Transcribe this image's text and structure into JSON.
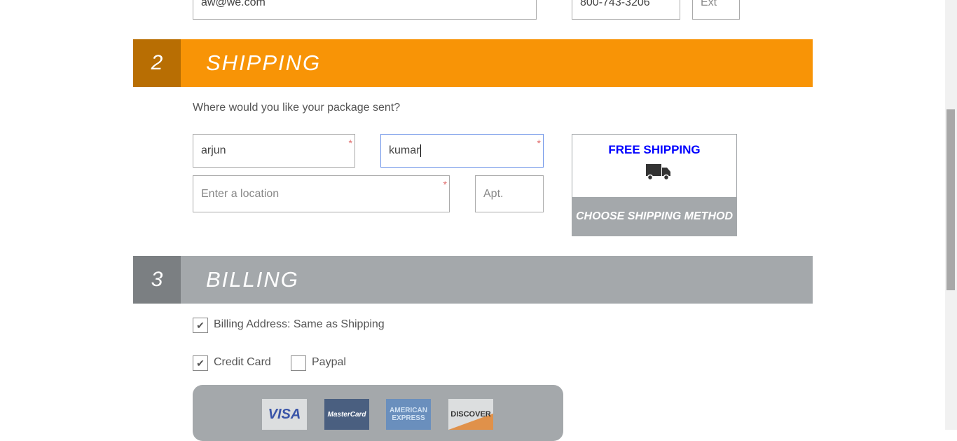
{
  "contact": {
    "email": "aw@we.com",
    "phone": "800-743-3206",
    "ext_placeholder": "Ext"
  },
  "shipping": {
    "number": "2",
    "title": "SHIPPING",
    "prompt": "Where would you like your package sent?",
    "first_name": "arjun",
    "last_name": "kumar",
    "location_placeholder": "Enter a location",
    "apt_placeholder": "Apt.",
    "free_shipping": "FREE SHIPPING",
    "choose_method": "CHOOSE SHIPPING METHOD"
  },
  "billing": {
    "number": "3",
    "title": "BILLING",
    "same_as_shipping": "Billing Address: Same as Shipping",
    "credit_card": "Credit Card",
    "paypal": "Paypal",
    "cards": [
      "VISA",
      "MasterCard",
      "AMERICAN EXPRESS",
      "DISCOVER"
    ]
  },
  "colors": {
    "orange": "#f89406",
    "orange_dark": "#b86e03",
    "gray": "#a4a8ab",
    "gray_dark": "#7b7f82"
  }
}
